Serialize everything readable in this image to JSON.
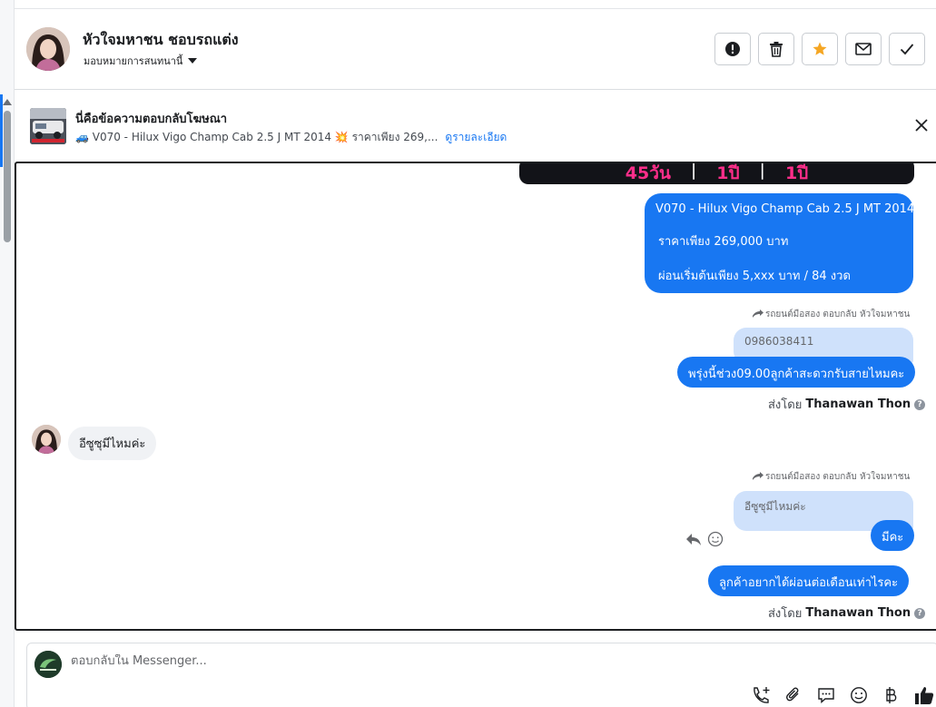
{
  "header": {
    "contact_name": "หัวใจมหาชน ชอบรถแต่ง",
    "assign_label": "มอบหมายการสนทนานี้",
    "actions": {
      "spam_icon": "exclamation-icon",
      "delete_icon": "trash-icon",
      "star_icon": "star-icon",
      "unread_icon": "envelope-icon",
      "done_icon": "check-icon"
    }
  },
  "ad_reply": {
    "title": "นี่คือข้อความตอบกลับโฆษณา",
    "description": "🚙 V070 - Hilux Vigo Champ Cab 2.5 J MT 2014 💥 ราคาเพียง 269,...",
    "details_link": "ดูรายละเอียด"
  },
  "chat": {
    "banner": {
      "col1": "45วัน",
      "col2": "1ปี",
      "col3": "1ปี",
      "sep": "|"
    },
    "ad_message": {
      "line1": "V070 - Hilux Vigo Champ Cab 2.5 J MT 2014",
      "line2": "ราคาเพียง 269,000 บาท",
      "line3": "ผ่อนเริ่มต้นเพียง 5,xxx บาท / 84 งวด"
    },
    "reply1": {
      "meta": "รถยนต์มือสอง ตอบกลับ หัวใจมหาชน",
      "quote": "0986038411",
      "text": "พรุ่งนี้ช่วง09.00ลูกค้าสะดวกรับสายไหมคะ",
      "sent_by_prefix": "ส่งโดย",
      "sent_by_name": "Thanawan Thon"
    },
    "incoming": {
      "text": "อีซูซุมีไหมค่ะ"
    },
    "reply2": {
      "meta": "รถยนต์มือสอง ตอบกลับ หัวใจมหาชน",
      "quote": "อีซูซุมีไหมค่ะ",
      "text": "มีคะ"
    },
    "message3": {
      "text": "ลูกค้าอยากได้ผ่อนต่อเดือนเท่าไรคะ",
      "sent_by_prefix": "ส่งโดย",
      "sent_by_name": "Thanawan Thon"
    }
  },
  "composer": {
    "placeholder": "ตอบกลับใน Messenger..."
  },
  "colors": {
    "accent": "#1877f2",
    "quote_bg": "#cfe1fb",
    "incoming_bg": "#f0f2f5",
    "star": "#f5a623"
  }
}
